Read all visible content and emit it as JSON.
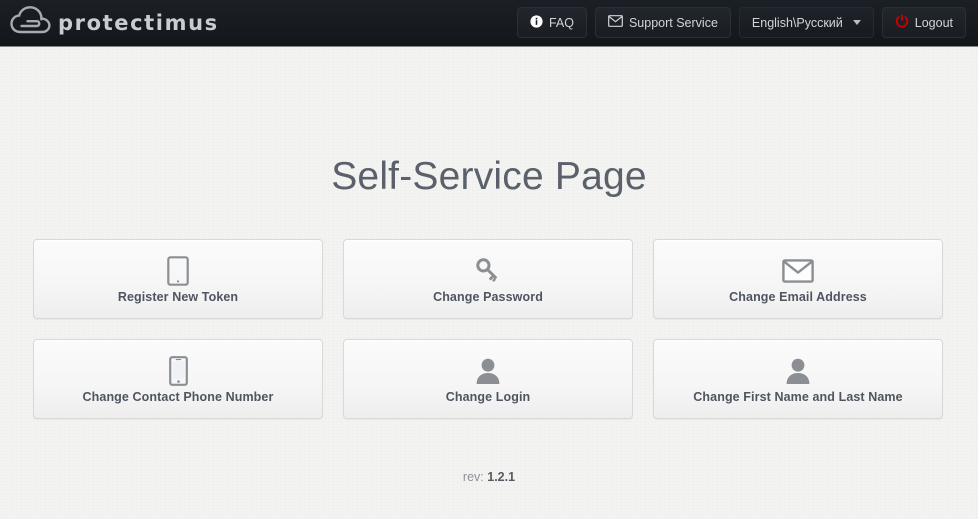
{
  "header": {
    "logo_text": "protectimus",
    "logo_icon": "cloud-arrow-logo",
    "buttons": [
      {
        "id": "faq",
        "label": "FAQ",
        "icon": "info-circle-icon"
      },
      {
        "id": "support",
        "label": "Support Service",
        "icon": "envelope-icon"
      },
      {
        "id": "language",
        "label": "English\\Русский",
        "icon": "chevron-down-icon"
      },
      {
        "id": "logout",
        "label": "Logout",
        "icon": "power-icon"
      }
    ],
    "logout_icon_color": "#cc0000"
  },
  "main": {
    "title": "Self-Service Page",
    "tiles": [
      {
        "label": "Register New Token",
        "icon": "tablet-icon"
      },
      {
        "label": "Change Password",
        "icon": "key-icon"
      },
      {
        "label": "Change Email Address",
        "icon": "envelope-icon"
      },
      {
        "label": "Change Contact Phone Number",
        "icon": "mobile-phone-icon"
      },
      {
        "label": "Change Login",
        "icon": "user-icon"
      },
      {
        "label": "Change First Name and Last Name",
        "icon": "user-icon"
      }
    ]
  },
  "footer": {
    "rev_prefix": "rev:",
    "rev_value": "1.2.1"
  },
  "colors": {
    "header_bg": "#171b20",
    "page_bg": "#f2f2f0",
    "title": "#5b616a",
    "tile_border": "#d8d8d8",
    "icon_gray": "#8b8f93",
    "accent_red": "#cc0000"
  }
}
